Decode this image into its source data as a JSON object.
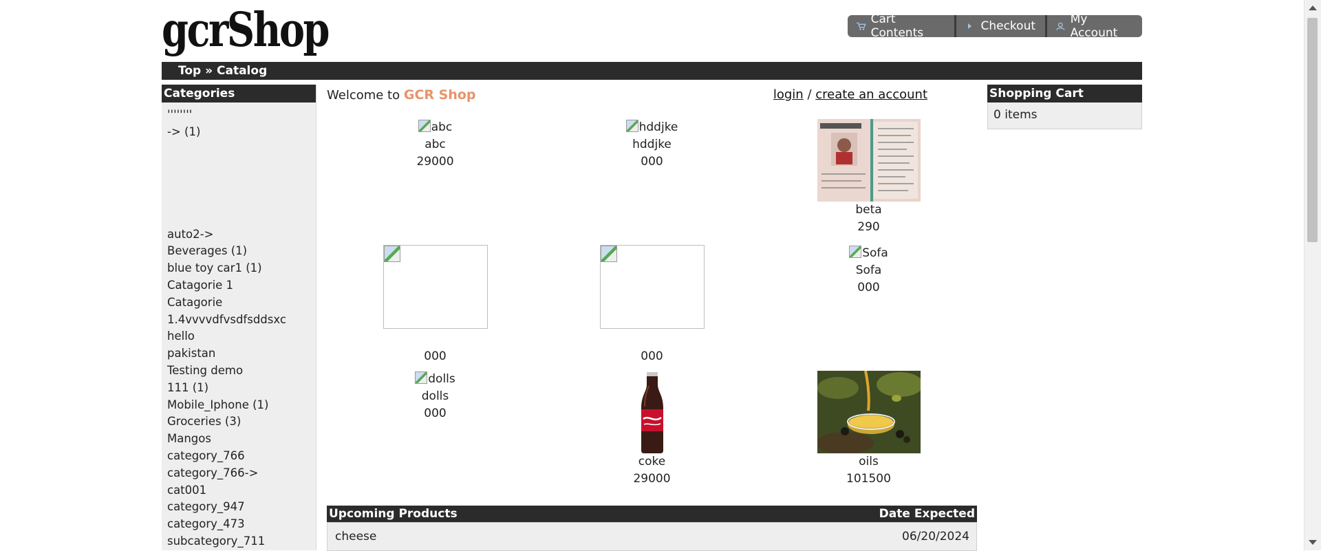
{
  "header": {
    "logo": "gcrShop",
    "nav": [
      {
        "label": "Cart Contents",
        "icon": "cart-icon"
      },
      {
        "label": "Checkout",
        "icon": "play-arrow-icon"
      },
      {
        "label": "My Account",
        "icon": "user-icon"
      }
    ]
  },
  "breadcrumb": {
    "top": "Top",
    "separator": "»",
    "current": "Catalog"
  },
  "categories": {
    "title": "Categories",
    "items": [
      "''''''''",
      "-> (1)",
      "auto2->",
      "Beverages (1)",
      "blue toy car1 (1)",
      "Catagorie 1",
      "Catagorie",
      "1.4vvvvdfvsdfsddsxc",
      "hello",
      "pakistan",
      "Testing demo",
      "111 (1)",
      "Mobile_Iphone (1)",
      "Groceries (3)",
      "Mangos",
      "category_766",
      "category_766->",
      "cat001",
      "category_947",
      "category_473",
      "subcategory_711"
    ]
  },
  "welcome": {
    "prefix": "Welcome to",
    "shop": "GCR Shop",
    "login": "login",
    "slash": "/",
    "create": "create an account"
  },
  "products": [
    {
      "alt": "abc",
      "name": "abc",
      "price": "29000"
    },
    {
      "alt": "hddjke",
      "name": "hddjke",
      "price": "000"
    },
    {
      "name": "beta",
      "price": "290"
    },
    {
      "name": "",
      "price": "000"
    },
    {
      "name": "",
      "price": "000"
    },
    {
      "alt": "Sofa",
      "name": "Sofa",
      "price": "000"
    },
    {
      "alt": "dolls",
      "name": "dolls",
      "price": "000"
    },
    {
      "name": "coke",
      "price": "29000"
    },
    {
      "name": "oils",
      "price": "101500"
    }
  ],
  "upcoming": {
    "title": "Upcoming Products",
    "date_header": "Date Expected",
    "rows": [
      {
        "name": "cheese",
        "date": "06/20/2024"
      }
    ]
  },
  "cart": {
    "title": "Shopping Cart",
    "items": "0 items"
  },
  "colors": {
    "bar": "#2b2b2b",
    "panel": "#eeeeee",
    "accent": "#e8936a",
    "nav": "#6a6a6a"
  }
}
